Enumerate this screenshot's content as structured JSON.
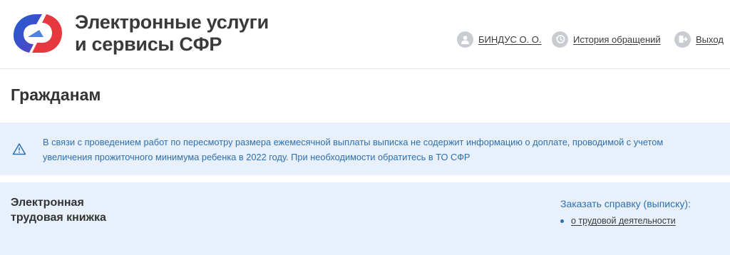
{
  "header": {
    "brand_line1": "Электронные услуги",
    "brand_line2": "и сервисы СФР",
    "logo_icon": "sfr-logo-icon",
    "nav": {
      "user": "БИНДУС О. О.",
      "history": "История обращений",
      "exit": "Выход"
    }
  },
  "page": {
    "title": "Гражданам"
  },
  "notice": {
    "icon": "warning-triangle-icon",
    "text": "В связи с проведением работ по пересмотру размера ежемесячной выплаты выписка не содержит информацию о доплате, проводимой с учетом увеличения прожиточного минимума ребенка в 2022 году. При необходимости обратитесь в ТО СФР"
  },
  "card": {
    "title_line1": "Электронная",
    "title_line2": "трудовая книжка",
    "order_label": "Заказать справку (выписку):",
    "links": [
      {
        "label": "о трудовой деятельности"
      }
    ]
  },
  "colors": {
    "brand_blue": "#2f6fd6",
    "brand_red": "#e8383f",
    "accent_text": "#2e6fb0",
    "panel_bg": "#e8f1fb",
    "icon_gray": "#c9ccd1"
  }
}
